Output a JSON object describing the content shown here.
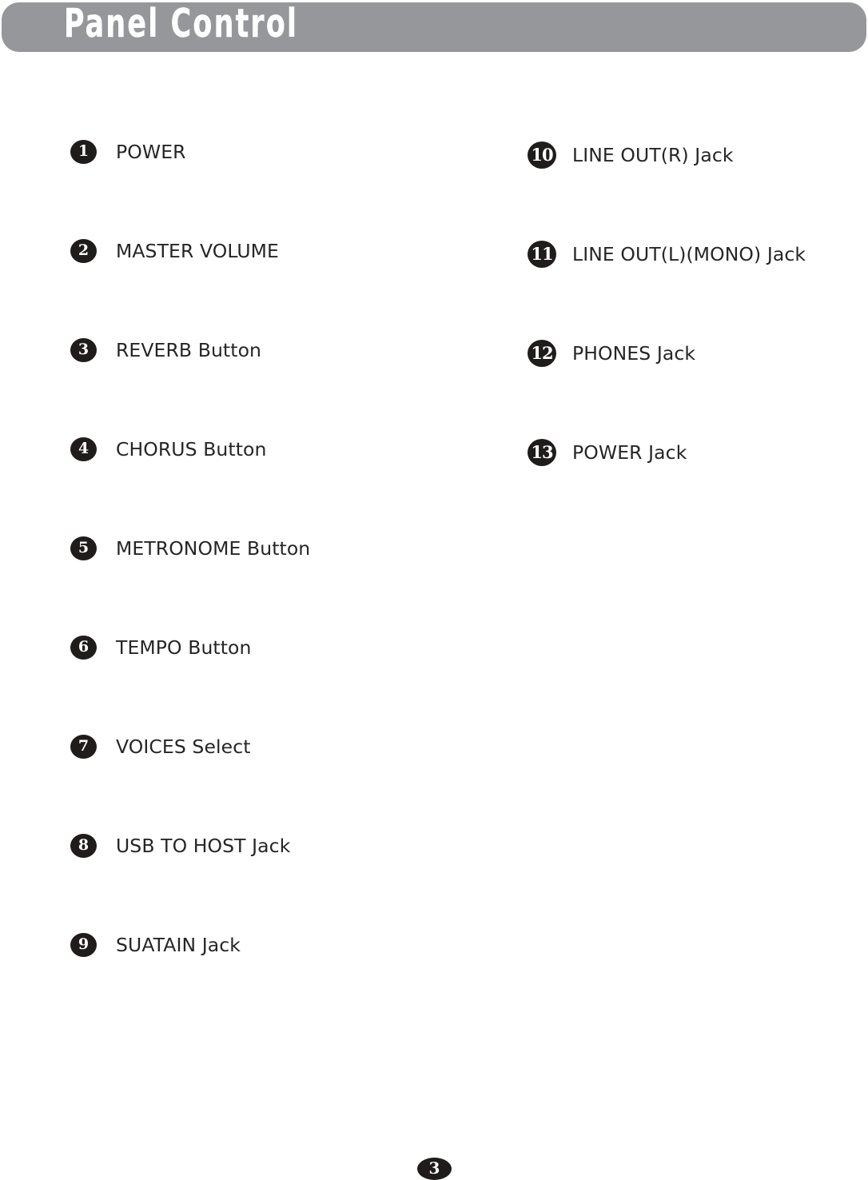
{
  "header": {
    "title": "Panel Control",
    "banner_color": "#95979a",
    "title_color": "#ffffff"
  },
  "badge": {
    "fill_color": "#201c1c",
    "text_color": "#ffffff"
  },
  "label_color": "#252525",
  "left_column": {
    "items": [
      {
        "number": "1",
        "label": "POWER"
      },
      {
        "number": "2",
        "label": "MASTER VOLUME"
      },
      {
        "number": "3",
        "label": "REVERB Button"
      },
      {
        "number": "4",
        "label": "CHORUS Button"
      },
      {
        "number": "5",
        "label": "METRONOME Button"
      },
      {
        "number": "6",
        "label": "TEMPO Button"
      },
      {
        "number": "7",
        "label": "VOICES Select"
      },
      {
        "number": "8",
        "label": "USB TO HOST Jack"
      },
      {
        "number": "9",
        "label": "SUATAIN Jack"
      }
    ]
  },
  "right_column": {
    "items": [
      {
        "number": "10",
        "label": "LINE OUT(R) Jack"
      },
      {
        "number": "11",
        "label": "LINE OUT(L)(MONO) Jack"
      },
      {
        "number": "12",
        "label": "PHONES Jack"
      },
      {
        "number": "13",
        "label": "POWER Jack"
      }
    ]
  },
  "footer": {
    "page_number": "3"
  }
}
